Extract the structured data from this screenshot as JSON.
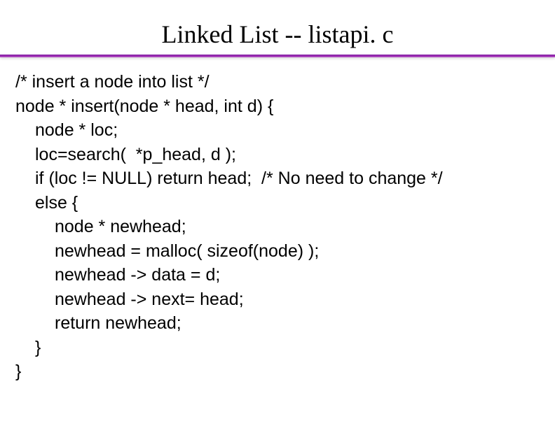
{
  "title": "Linked List -- listapi. c",
  "code": {
    "lines": [
      {
        "indent": 0,
        "text": "/* insert a node into list */"
      },
      {
        "indent": 0,
        "text": "node * insert(node * head, int d) {"
      },
      {
        "indent": 1,
        "text": "node * loc;"
      },
      {
        "indent": 1,
        "text": "loc=search(  *p_head, d );"
      },
      {
        "indent": 1,
        "text": "if (loc != NULL) return head;  /* No need to change */"
      },
      {
        "indent": 1,
        "text": "else {"
      },
      {
        "indent": 2,
        "text": "node * newhead;"
      },
      {
        "indent": 2,
        "text": "newhead = malloc( sizeof(node) );"
      },
      {
        "indent": 2,
        "text": "newhead -> data = d;"
      },
      {
        "indent": 2,
        "text": "newhead -> next= head;"
      },
      {
        "indent": 2,
        "text": "return newhead;"
      },
      {
        "indent": 1,
        "text": "}"
      },
      {
        "indent": 0,
        "text": "}"
      }
    ]
  }
}
